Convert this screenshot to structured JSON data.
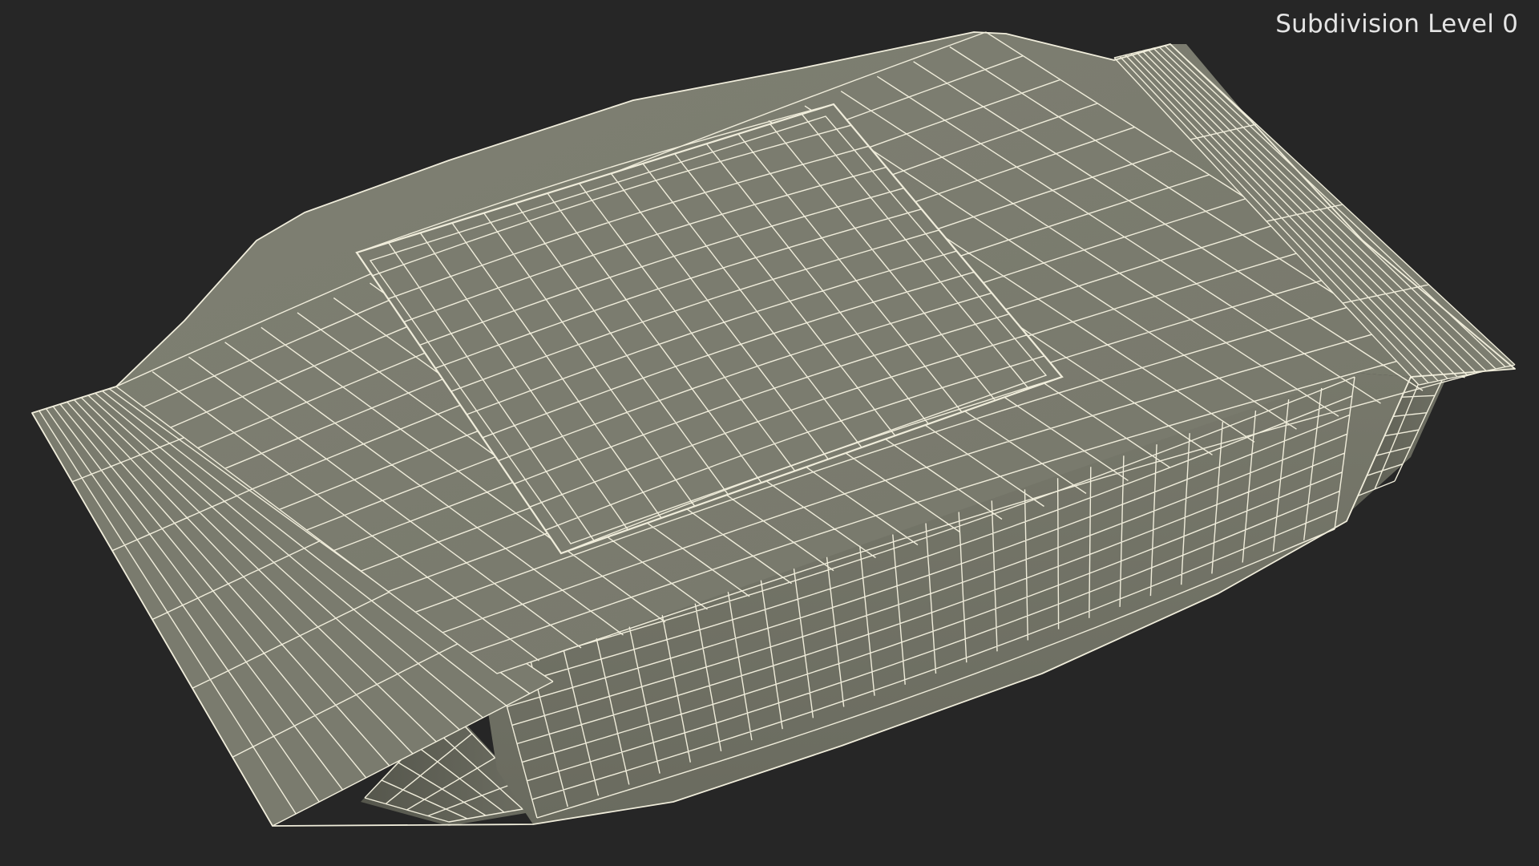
{
  "viewport": {
    "background_color": "#262626",
    "overlay_label": "Subdivision Level 0"
  },
  "model": {
    "description_icon": "wireframe-snack-bag",
    "surface_color": "#7a7b6e",
    "wire_color": "#f0eddb"
  }
}
